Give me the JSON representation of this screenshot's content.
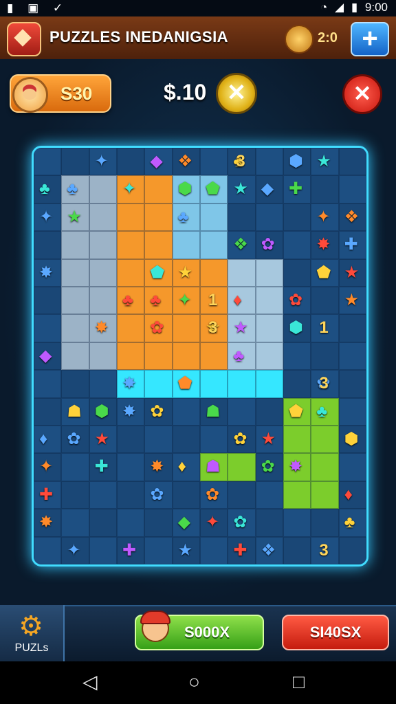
{
  "status_bar": {
    "time": "9:00",
    "left_icons": [
      "notification-icon",
      "image-icon",
      "check-icon"
    ],
    "right_icons": [
      "wifi-icon",
      "signal-icon",
      "battery-icon"
    ]
  },
  "header": {
    "title": "PUZZLES INEDANIGSIA",
    "coin_value": "2:0",
    "plus_label": "+"
  },
  "hud": {
    "coins": "S30",
    "price": "$.10",
    "gold_button_icon": "x-icon",
    "close_icon": "close-icon"
  },
  "board": {
    "border_color": "#41dcff",
    "numbers": [
      "3",
      "1",
      "3",
      "1",
      "3",
      "3"
    ]
  },
  "bottom": {
    "puzzles_tab": "PUZLs",
    "green_button": "S000X",
    "red_button": "SI40SX"
  },
  "colors": {
    "orange": "#f5982b",
    "green": "#7ccd2c",
    "cyan": "#35e7ff",
    "board": "#1b4a7a"
  }
}
